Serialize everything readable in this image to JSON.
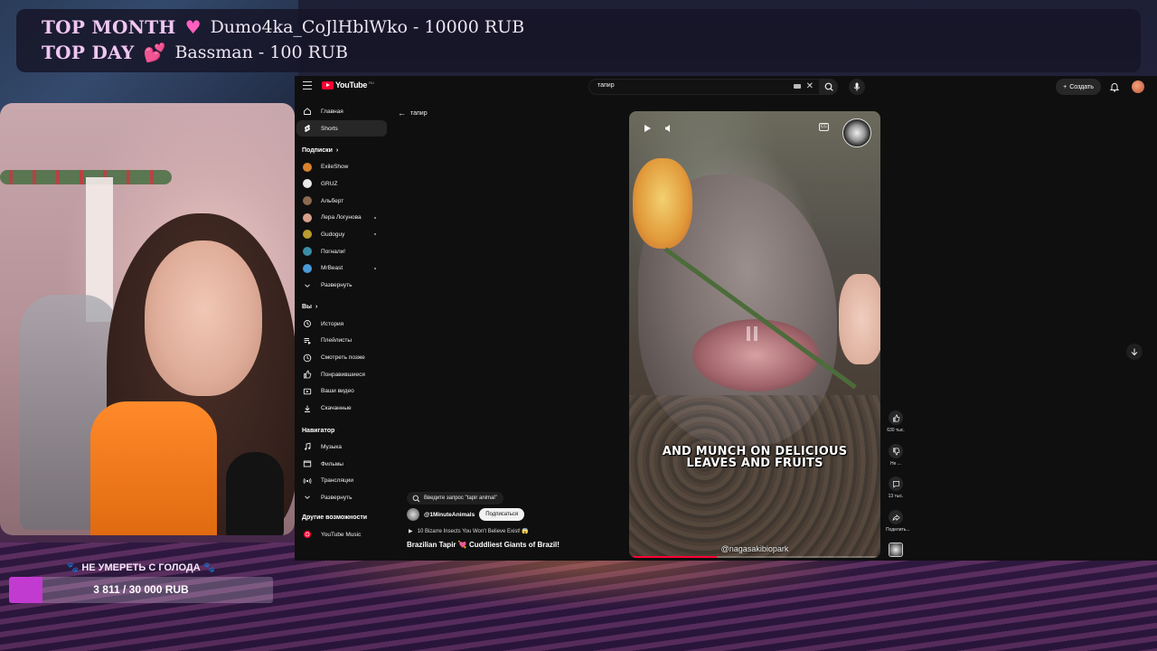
{
  "overlay": {
    "top_month_label": "TOP MONTH",
    "top_month_value": "Dumo4ka_CoJlHblWko - 10000 RUB",
    "top_day_label": "TOP DAY",
    "top_day_value": "Bassman - 100 RUB",
    "goal_title": "🐾 НЕ УМЕРЕТЬ С ГОЛОДА 🐾",
    "goal_text": "3 811 / 30 000 RUB",
    "goal_progress": 0.127,
    "goal_color": "#c23bd0"
  },
  "youtube": {
    "logo_text": "YouTube",
    "logo_region": "RU",
    "search": {
      "value": "тапир"
    },
    "create_label": "Создать",
    "back_label": "тапир",
    "sidebar": {
      "main": [
        {
          "label": "Главная",
          "icon": "home-icon"
        },
        {
          "label": "Shorts",
          "icon": "shorts-icon",
          "active": true
        }
      ],
      "subs_header": "Подписки",
      "subs": [
        {
          "label": "ExileShow",
          "color": "#d9822b"
        },
        {
          "label": "GRUZ",
          "color": "#e8e8e8"
        },
        {
          "label": "Альберт",
          "color": "#8a6a52"
        },
        {
          "label": "Лера Логунова",
          "color": "#d8a08a",
          "dot": true
        },
        {
          "label": "Gudoguy",
          "color": "#b99b2e",
          "dot": true
        },
        {
          "label": "Погнали!",
          "color": "#3b8ea5"
        },
        {
          "label": "MrBeast",
          "color": "#4a9ad8",
          "dot": true
        }
      ],
      "expand_label": "Развернуть",
      "you_header": "Вы",
      "you": [
        {
          "label": "История",
          "icon": "history-icon"
        },
        {
          "label": "Плейлисты",
          "icon": "playlists-icon"
        },
        {
          "label": "Смотреть позже",
          "icon": "watch-later-icon"
        },
        {
          "label": "Понравившиеся",
          "icon": "like-icon"
        },
        {
          "label": "Ваши видео",
          "icon": "your-videos-icon"
        },
        {
          "label": "Скачанные",
          "icon": "download-icon"
        }
      ],
      "nav_header": "Навигатор",
      "nav": [
        {
          "label": "Музыка",
          "icon": "music-icon"
        },
        {
          "label": "Фильмы",
          "icon": "movies-icon"
        },
        {
          "label": "Трансляции",
          "icon": "live-icon"
        },
        {
          "label": "Развернуть",
          "icon": "chevron-down-icon"
        }
      ],
      "more_header": "Другие возможности",
      "more": [
        {
          "label": "YouTube Music",
          "icon": "youtube-music-icon"
        }
      ]
    },
    "short": {
      "search_chip": "Введите запрос \"tapir animal\"",
      "channel": "@1MinuteAnimals",
      "subscribe_label": "Подписаться",
      "playlist": "10 Bizarre Insects You Won't Believe Exist! 😱",
      "title": "Brazilian Tapir 💘 Cuddliest Giants of Brazil!",
      "caption_line1": "AND MUNCH ON DELICIOUS",
      "caption_line2": "LEAVES AND FRUITS",
      "watermark": "@nagasakibiopark",
      "cc_label": "CC",
      "progress": 0.35,
      "likes": "630 тыс.",
      "dislike_label": "Не ...",
      "comments": "13 тыс.",
      "share_label": "Поделить..."
    }
  }
}
